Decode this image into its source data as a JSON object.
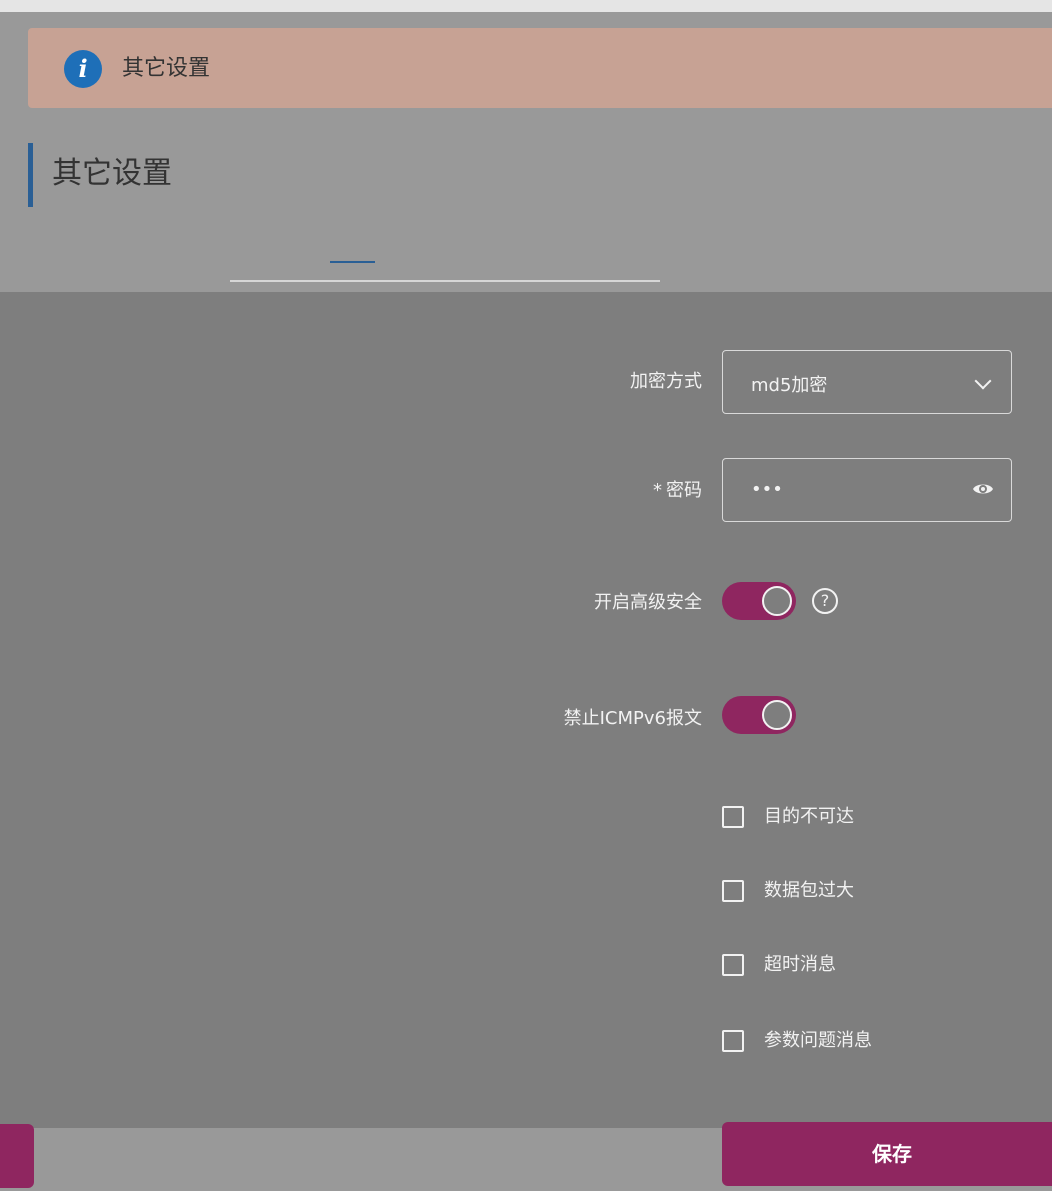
{
  "banner": {
    "text": "其它设置"
  },
  "section": {
    "title": "其它设置"
  },
  "form": {
    "encryption": {
      "label": "加密方式",
      "value": "md5加密"
    },
    "password": {
      "label": "密码",
      "required_mark": "*",
      "value": "•••"
    },
    "advanced_security": {
      "label": "开启高级安全",
      "enabled": true,
      "help_glyph": "?"
    },
    "block_icmpv6": {
      "label": "禁止ICMPv6报文",
      "enabled": true
    },
    "icmp_options": [
      {
        "label": "目的不可达",
        "checked": false
      },
      {
        "label": "数据包过大",
        "checked": false
      },
      {
        "label": "超时消息",
        "checked": false
      },
      {
        "label": "参数问题消息",
        "checked": false
      }
    ]
  },
  "footer": {
    "save_label": "保存"
  },
  "colors": {
    "accent": "#8f2660",
    "banner_bg": "#c7a294",
    "info_icon": "#1e6fb8",
    "title_bar": "#2a5f95"
  },
  "icons": {
    "banner": "info-icon",
    "select": "chevron-down-icon",
    "password": "eye-icon",
    "help": "question-circle-icon"
  }
}
